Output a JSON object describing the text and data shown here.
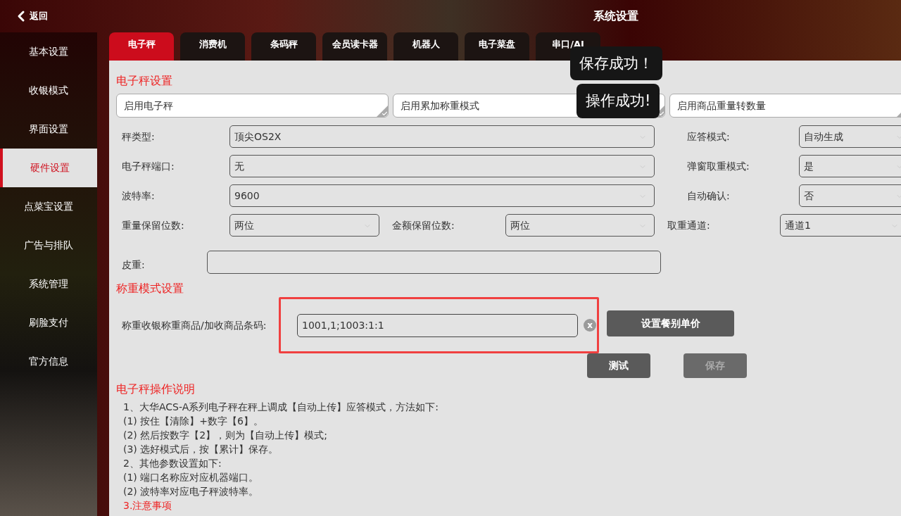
{
  "header": {
    "back": "返回",
    "title": "系统设置"
  },
  "sidebar": {
    "items": [
      {
        "label": "基本设置",
        "selected": false
      },
      {
        "label": "收银模式",
        "selected": false
      },
      {
        "label": "界面设置",
        "selected": false
      },
      {
        "label": "硬件设置",
        "selected": true
      },
      {
        "label": "点菜宝设置",
        "selected": false
      },
      {
        "label": "广告与排队",
        "selected": false
      },
      {
        "label": "系统管理",
        "selected": false
      },
      {
        "label": "刷脸支付",
        "selected": false
      },
      {
        "label": "官方信息",
        "selected": false
      }
    ]
  },
  "tabs": [
    {
      "label": "电子秤",
      "selected": true
    },
    {
      "label": "消费机",
      "selected": false
    },
    {
      "label": "条码秤",
      "selected": false
    },
    {
      "label": "会员读卡器",
      "selected": false
    },
    {
      "label": "机器人",
      "selected": false
    },
    {
      "label": "电子菜盘",
      "selected": false
    },
    {
      "label": "串口/AI",
      "selected": false
    }
  ],
  "scale_settings": {
    "title": "电子秤设置",
    "toggles": [
      {
        "label": "启用电子秤",
        "checked": false
      },
      {
        "label": "启用累加称重模式",
        "checked": false
      },
      {
        "label": "启用商品重量转数量",
        "checked": false
      }
    ],
    "rows": [
      {
        "label": "秤类型:",
        "value": "顶尖OS2X",
        "side_label": "应答模式:",
        "side_value": "自动生成"
      },
      {
        "label": "电子秤端口:",
        "value": "无",
        "side_label": "弹窗取重模式:",
        "side_value": "是"
      },
      {
        "label": "波特率:",
        "value": "9600",
        "side_label": "自动确认:",
        "side_value": "否"
      }
    ],
    "decimals_row": {
      "weight_label": "重量保留位数:",
      "weight_value": "两位",
      "amount_label": "金额保留位数:",
      "amount_value": "两位",
      "channel_label": "取重通道:",
      "channel_value": "通道1"
    },
    "tare": {
      "label": "皮重:"
    }
  },
  "weighing_mode": {
    "title": "称重模式设置",
    "label": "称重收银称重商品/加收商品条码:",
    "value": "1001,1;1003:1:1",
    "highlighted": true,
    "clear": "x",
    "buttons": [
      {
        "label": "设置餐别单价",
        "disabled": false
      },
      {
        "label": "测试",
        "disabled": false
      },
      {
        "label": "保存",
        "disabled": true
      }
    ]
  },
  "instructions": {
    "title": "电子秤操作说明",
    "lines": [
      {
        "text": "1、大华ACS-A系列电子秤在秤上调成【自动上传】应答模式，方法如下:",
        "kind": "normal"
      },
      {
        "text": "(1) 按住【清除】+数字【6】。",
        "kind": "normal"
      },
      {
        "text": "(2) 然后按数字【2】，则为【自动上传】模式;",
        "kind": "normal"
      },
      {
        "text": "(3) 选好模式后，按【累计】保存。",
        "kind": "normal"
      },
      {
        "text": "2、其他参数设置如下:",
        "kind": "normal"
      },
      {
        "text": "(1) 端口名称应对应机器端口。",
        "kind": "normal"
      },
      {
        "text": "(2) 波特率对应电子秤波特率。",
        "kind": "normal"
      },
      {
        "text": "3.注意事项",
        "kind": "warning"
      }
    ]
  },
  "toasts": [
    "保存成功！",
    "操作成功!"
  ]
}
